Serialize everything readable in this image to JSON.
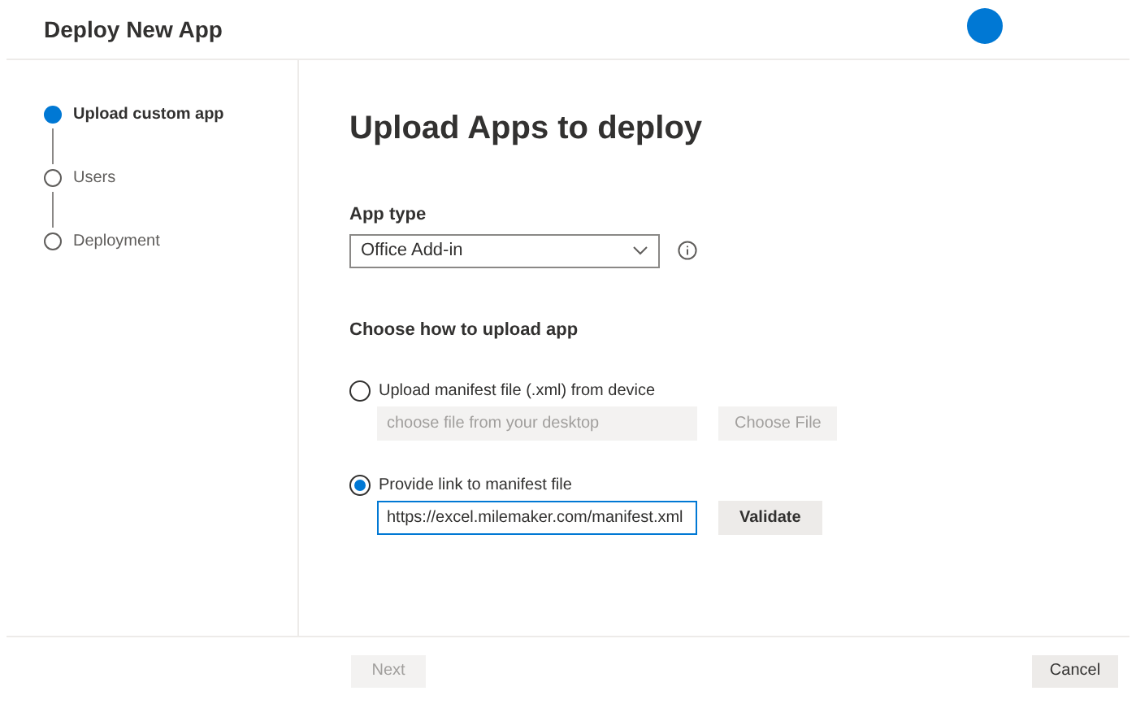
{
  "header": {
    "title": "Deploy New App"
  },
  "steps": [
    {
      "label": "Upload custom app",
      "selected": true
    },
    {
      "label": "Users",
      "selected": false
    },
    {
      "label": "Deployment",
      "selected": false
    }
  ],
  "heading": "Upload Apps to deploy",
  "app_type": {
    "label": "App type",
    "value": "Office Add-in"
  },
  "upload": {
    "label": "Choose how to upload app",
    "options": [
      {
        "kind": "file",
        "label": "Upload manifest file (.xml) from device",
        "selected": false,
        "field": {
          "placeholder": "choose file from your desktop"
        },
        "button": {
          "label": "Choose File",
          "disabled": true
        }
      },
      {
        "kind": "link",
        "label": "Provide link to manifest file",
        "selected": true,
        "field": {
          "value": "https://excel.milemaker.com/manifest.xml"
        },
        "button": {
          "label": "Validate",
          "disabled": false
        }
      }
    ]
  },
  "footer": {
    "buttons": [
      {
        "label": "Next",
        "disabled": true
      },
      {
        "label": "Cancel",
        "disabled": false
      }
    ]
  }
}
